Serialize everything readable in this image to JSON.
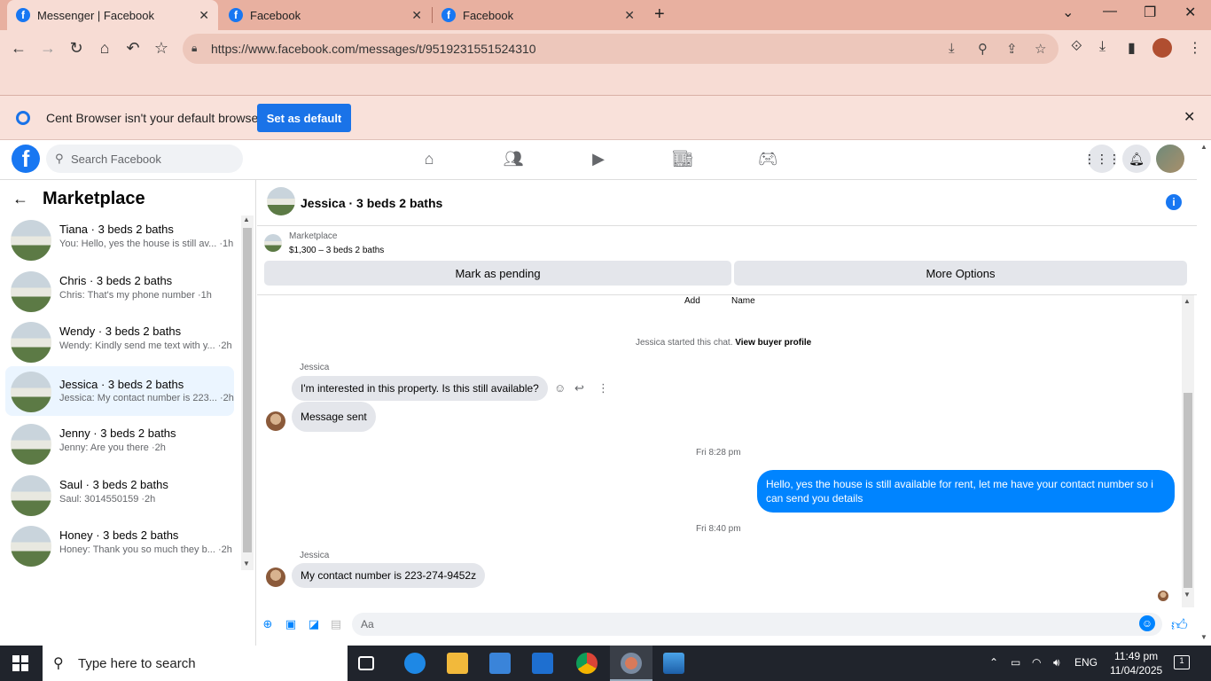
{
  "browser": {
    "tabs": [
      {
        "title": "Messenger | Facebook",
        "active": true
      },
      {
        "title": "Facebook",
        "active": false
      },
      {
        "title": "Facebook",
        "active": false
      }
    ],
    "url": "https://www.facebook.com/messages/t/9519231551524310",
    "infobar": {
      "message": "Cent Browser isn't your default browser",
      "button_label": "Set as default"
    }
  },
  "facebook": {
    "search_placeholder": "Search Facebook",
    "logo_letter": "f"
  },
  "marketplace": {
    "title": "Marketplace",
    "conversations": [
      {
        "name": "Tiana · 3 beds 2 baths",
        "preview": "You: Hello, yes the house is still av... ·1h",
        "selected": false
      },
      {
        "name": "Chris · 3 beds 2 baths",
        "preview": "Chris: That's my phone number ·1h",
        "selected": false
      },
      {
        "name": "Wendy · 3 beds 2 baths",
        "preview": "Wendy: Kindly send me text with y... ·2h",
        "selected": false
      },
      {
        "name": "Jessica · 3 beds 2 baths",
        "preview": "Jessica: My contact number is 223... ·2h",
        "selected": true
      },
      {
        "name": "Jenny · 3 beds 2 baths",
        "preview": "Jenny: Are you there ·2h",
        "selected": false
      },
      {
        "name": "Saul · 3 beds 2 baths",
        "preview": "Saul: 3014550159 ·2h",
        "selected": false
      },
      {
        "name": "Honey · 3 beds 2 baths",
        "preview": "Honey: Thank you so much they b... ·2h",
        "selected": false
      }
    ]
  },
  "chat": {
    "title": "Jessica · 3 beds 2 baths",
    "listing": {
      "source": "Marketplace",
      "price_line": "$1,300 – 3 beds 2 baths",
      "mark_pending_label": "Mark as pending",
      "more_options_label": "More Options"
    },
    "top_labels": {
      "add": "Add",
      "name": "Name"
    },
    "started_note": "Jessica started this chat.",
    "view_profile_label": "View buyer profile",
    "messages": {
      "sender1": "Jessica",
      "msg1": "I'm interested in this property. Is this still available?",
      "msg2": "Message sent",
      "time1": "Fri 8:28 pm",
      "msg3": "Hello, yes the house is still available for rent, let me have your contact number so i can send you details",
      "time2": "Fri 8:40 pm",
      "sender2": "Jessica",
      "msg4": "My contact number is 223-274-9452z"
    },
    "composer_placeholder": "Aa"
  },
  "taskbar": {
    "search_placeholder": "Type here to search",
    "language": "ENG",
    "time": "11:49 pm",
    "date": "11/04/2025",
    "notifications": "1"
  }
}
